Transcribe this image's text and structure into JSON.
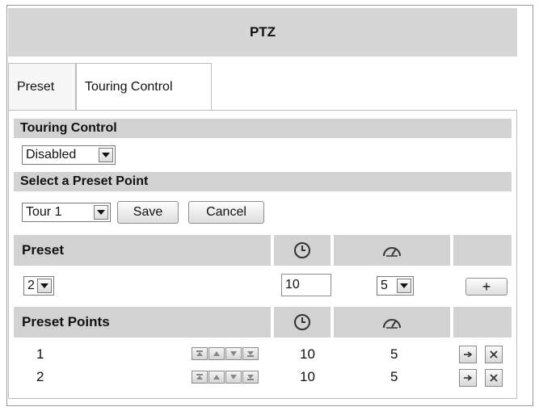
{
  "header": {
    "title": "PTZ"
  },
  "tabs": [
    {
      "label": "Preset"
    },
    {
      "label": "Touring Control"
    }
  ],
  "touring": {
    "section_title": "Touring Control",
    "mode_value": "Disabled"
  },
  "select_preset": {
    "section_title": "Select a Preset Point",
    "tour_value": "Tour 1",
    "save_label": "Save",
    "cancel_label": "Cancel"
  },
  "preset_editor": {
    "header_label": "Preset",
    "preset_value": "2",
    "dwell_value": "10",
    "speed_value": "5",
    "add_symbol": "+"
  },
  "preset_points": {
    "header_label": "Preset Points",
    "rows": [
      {
        "index": "1",
        "dwell": "10",
        "speed": "5"
      },
      {
        "index": "2",
        "dwell": "10",
        "speed": "5"
      }
    ]
  },
  "icons": {
    "clock": "clock-icon",
    "speed": "speedometer-icon",
    "goto": "arrow-right-icon",
    "delete": "close-icon",
    "move_top": "move-top-icon",
    "move_up": "move-up-icon",
    "move_down": "move-down-icon",
    "move_bottom": "move-bottom-icon"
  }
}
